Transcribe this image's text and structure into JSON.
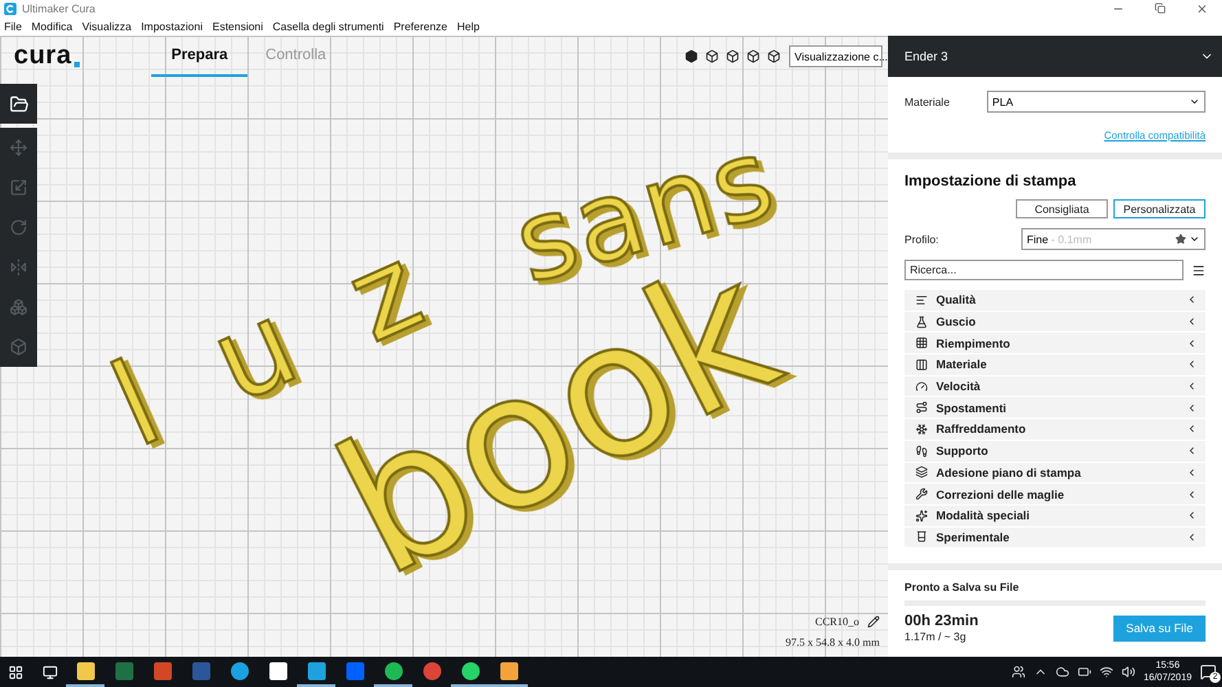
{
  "window": {
    "title": "Ultimaker Cura"
  },
  "menu": [
    "File",
    "Modifica",
    "Visualizza",
    "Impostazioni",
    "Estensioni",
    "Casella degli strumenti",
    "Preferenze",
    "Help"
  ],
  "header": {
    "logo": "cura",
    "tabs": [
      {
        "label": "Prepara",
        "selected": true
      },
      {
        "label": "Controlla",
        "selected": false
      }
    ],
    "view_select": "Visualizzazione c..."
  },
  "tools": [
    {
      "kind": "open",
      "disabled": false
    },
    {
      "kind": "move",
      "disabled": true
    },
    {
      "kind": "scale",
      "disabled": true
    },
    {
      "kind": "rotate",
      "disabled": true
    },
    {
      "kind": "mirror",
      "disabled": true
    },
    {
      "kind": "per-model",
      "disabled": true
    },
    {
      "kind": "support-blocker",
      "disabled": true
    }
  ],
  "model_text": [
    "l u z",
    "sans",
    "book"
  ],
  "object_info": {
    "name": "CCR10_o",
    "dimensions": "97.5 x 54.8 x 4.0 mm"
  },
  "printer": {
    "name": "Ender 3"
  },
  "material": {
    "label": "Materiale",
    "value": "PLA",
    "link": "Controlla compatibilità"
  },
  "print_setup": {
    "title": "Impostazione di stampa",
    "modes": [
      {
        "label": "Consigliata",
        "selected": false
      },
      {
        "label": "Personalizzata",
        "selected": true
      }
    ],
    "profile": {
      "label": "Profilo:",
      "value": "Fine",
      "detail": " - 0.1mm"
    },
    "search": {
      "placeholder": "Ricerca..."
    },
    "categories": [
      "Qualità",
      "Guscio",
      "Riempimento",
      "Materiale",
      "Velocità",
      "Spostamenti",
      "Raffreddamento",
      "Supporto",
      "Adesione piano di stampa",
      "Correzioni delle maglie",
      "Modalità speciali",
      "Sperimentale"
    ]
  },
  "output": {
    "status": "Pronto a Salva su File",
    "time": "00h 23min",
    "usage": "1.17m / ~ 3g",
    "button": "Salva su File"
  },
  "taskbar": {
    "apps": [
      {
        "kind": "explorer",
        "running": true
      },
      {
        "kind": "excel",
        "running": false
      },
      {
        "kind": "powerpoint",
        "running": false
      },
      {
        "kind": "word",
        "running": false
      },
      {
        "kind": "ie",
        "running": false
      },
      {
        "kind": "mail",
        "running": false
      },
      {
        "kind": "cura",
        "running": true
      },
      {
        "kind": "dropbox",
        "running": false
      },
      {
        "kind": "spotify",
        "running": true
      },
      {
        "kind": "chrome",
        "running": false
      },
      {
        "kind": "whatsapp",
        "running": true
      },
      {
        "kind": "fusion",
        "running": true
      }
    ],
    "time": "15:56",
    "date": "16/07/2019",
    "notifications": "2"
  }
}
